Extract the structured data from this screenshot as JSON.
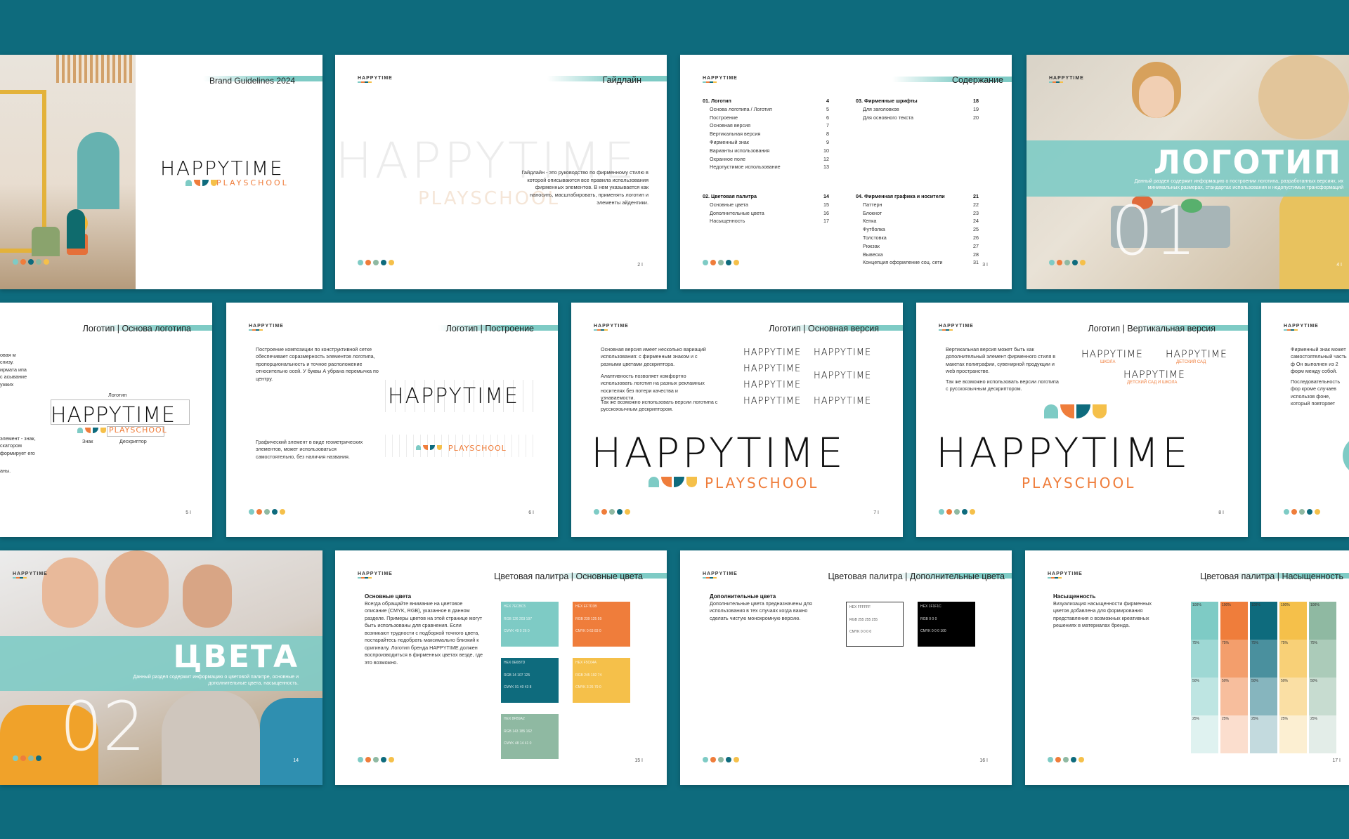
{
  "colors": {
    "bg": "#0e6b7d",
    "teal": "#7ecbc5",
    "orange": "#ef7d3b",
    "dark_teal": "#0e6b7d",
    "yellow": "#f5c04a",
    "sage": "#8fb9a2"
  },
  "brand": {
    "name": "HAPPYTIME",
    "sub": "PLAYSCHOOL",
    "mini": "HAPPYTIME"
  },
  "s1": {
    "title": "Brand Guidelines 2024"
  },
  "s2": {
    "title": "Гайдлайн",
    "text": "Гайдлайн - это руководство по фирменному стилю в которой описываются все правила использования фирменных элементов. В нем указывается как наносить, масштабировать, применять логотип и элементы айдентики.",
    "page": "2 I"
  },
  "s3": {
    "title": "Содержание",
    "page": "3 I",
    "col1": [
      {
        "label": "01. Логотип",
        "num": "4",
        "head": true
      },
      {
        "label": "Основа логотипа / Логотип",
        "num": "5"
      },
      {
        "label": "Построение",
        "num": "6"
      },
      {
        "label": "Основная версия",
        "num": "7"
      },
      {
        "label": "Вертикальная версия",
        "num": "8"
      },
      {
        "label": "Фирменный знак",
        "num": "9"
      },
      {
        "label": "Варианты использования",
        "num": "10"
      },
      {
        "label": "Охранное поле",
        "num": "12"
      },
      {
        "label": "Недопустимое использование",
        "num": "13"
      }
    ],
    "col1b": [
      {
        "label": "02. Цветовая палитра",
        "num": "14",
        "head": true
      },
      {
        "label": "Основные цвета",
        "num": "15"
      },
      {
        "label": "Дополнительные цвета",
        "num": "16"
      },
      {
        "label": "Насыщенность",
        "num": "17"
      }
    ],
    "col2": [
      {
        "label": "03. Фирменные шрифты",
        "num": "18",
        "head": true
      },
      {
        "label": "Для заголовков",
        "num": "19"
      },
      {
        "label": "Для основного текста",
        "num": "20"
      }
    ],
    "col2b": [
      {
        "label": "04. Фирменная графика и носители",
        "num": "21",
        "head": true
      },
      {
        "label": "Паттерн",
        "num": "22"
      },
      {
        "label": "Блокнот",
        "num": "23"
      },
      {
        "label": "Кепка",
        "num": "24"
      },
      {
        "label": "Футболка",
        "num": "25"
      },
      {
        "label": "Толстовка",
        "num": "26"
      },
      {
        "label": "Рюкзак",
        "num": "27"
      },
      {
        "label": "Вывеска",
        "num": "28"
      },
      {
        "label": "Концепция оформление соц. сети",
        "num": "31"
      }
    ]
  },
  "s4": {
    "title": "ЛОГОТИП",
    "num": "01",
    "desc": "Данный раздел содержит информацию о построении логотипа, разработанных версиях, их минимальных размерах, стандартах использования и недопустимых трансформаций",
    "page": "4 I"
  },
  "s5": {
    "title": "Логотип | Основа логотипа",
    "label_logo": "Логотип",
    "label_sign": "Знак",
    "label_desc": "Дескриптор",
    "text1": "овая м снизу. ирмата ипа с асывание ужких",
    "text2": "элемент - знак, скатором формирует его",
    "text3": "аны.",
    "page": "5 I"
  },
  "s6": {
    "title": "Логотип | Построение",
    "text1": "Построение композиции по конструктивной сетке обеспечивает соразмерность элементов логотипа, пропорциональность и точное расположение относительно осей. У буквы А убрана перемычка по центру.",
    "text2": "Графический элемент в виде геометрических элементов, может использоваться самостоятельно, без наличия названия.",
    "page": "6 I"
  },
  "s7": {
    "title": "Логотип | Основная версия",
    "text1": "Основная версия имеет несколько вариаций использования: с фирменным знаком и с разными цветами дескриптора.",
    "text2": "Алаптивность позволяет комфортно использовать логотип на разных рекламных носителях без потери качества и узнаваемости.",
    "text3": "Так же возможно использовать версии логотипа с русскоязычным дескриптором.",
    "page": "7 I"
  },
  "s8": {
    "title": "Логотип | Вертикальная версия",
    "text1": "Вертикальная версия может быть как дополнительный элемент фирменного стиля в макетах полиграфии, сувенирной продукции и web пространстве.",
    "text2": "Так же возможно использовать версии логотипа с русскоязычным дескриптором.",
    "sub_school": "ШКОЛА",
    "sub_kinder": "ДЕТСКИЙ САД",
    "sub_both": "ДЕТСКИЙ САД И ШКОЛА",
    "page": "8 I"
  },
  "s9": {
    "text1": "Фирменный знак может самостоятельный часть ф Он выполнен из 2 форм между собой.",
    "text2": "Последовательность фор кроме случаев использов фоне, который повторяет"
  },
  "s10": {
    "title": "ЦВЕТА",
    "num": "02",
    "desc": "Данный раздел содержит информацию о цветовой палитре, основные и дополнительные цвета, насыщенность.",
    "page": "14"
  },
  "s11": {
    "title": "Цветовая палитра | Основные цвета",
    "head": "Основные цвета",
    "text": "Всегда обращайте внимание на цветовое описание (CMYK, RGB), указанное в данном разделе. Примеры цветов на этой странице могут быть использованы для сравнения. Если возникают трудности с подборкой точного цвета, постарайтесь подобрать максимально близкий к оригиналу. Логотип бренда HAPPYTIME должен воспроизводиться в фирменных цветах везде, где это возможно.",
    "page": "15 I",
    "swatches": [
      {
        "hex": "HEX 7ECBC5",
        "rgb": "RGB 126 203 197",
        "cmyk": "CMYK 49 0 26 0"
      },
      {
        "hex": "HEX EF7D3B",
        "rgb": "RGB 239 125 59",
        "cmyk": "CMYK 0 63 83 0"
      },
      {
        "hex": "HEX 0E6B7D",
        "rgb": "RGB 14 107 125",
        "cmyk": "CMYK 91 40 43 8"
      },
      {
        "hex": "HEX F5C04A",
        "rgb": "RGB 245 192 74",
        "cmyk": "CMYK 3 26 79 0"
      },
      {
        "hex": "HEX 8FB9A2",
        "rgb": "RGB 143 185 162",
        "cmyk": "CMYK 48 14 41 0"
      }
    ]
  },
  "s12": {
    "title": "Цветовая палитра | Дополнительные цвета",
    "head": "Дополнительные цвета",
    "text": "Дополнительные цвета предназначены для использования в тех случаях когда важно сделать чистую монохромную версию.",
    "white": {
      "hex": "HEX FFFFFF",
      "rgb": "RGB 255 255 255",
      "cmyk": "CMYK 0 0 0 0"
    },
    "black": {
      "hex": "HEX 1F1F1C",
      "rgb": "RGB 0 0 0",
      "cmyk": "CMYK 0 0 0 100"
    },
    "page": "16 I"
  },
  "s13": {
    "title": "Цветовая палитра | Насыщенность",
    "head": "Насыщенность",
    "text": "Визуализация насыщенности фирменных цветов добавлена для формирования представления о возможных креативных решениях в материалах бренда.",
    "levels": [
      "100%",
      "75%",
      "50%",
      "25%"
    ],
    "page": "17 I"
  }
}
